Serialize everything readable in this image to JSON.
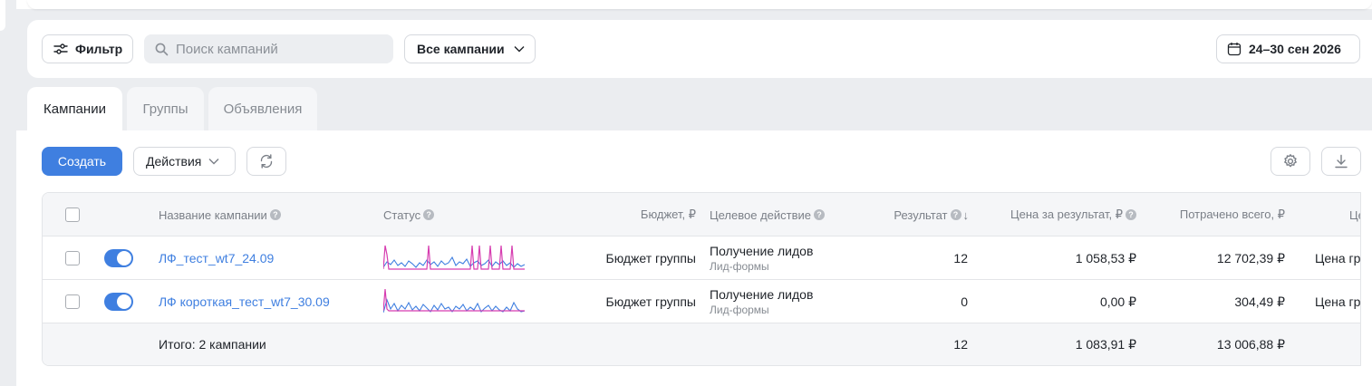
{
  "filter_bar": {
    "filter_label": "Фильтр",
    "search_placeholder": "Поиск кампаний",
    "campaign_select": "Все кампании",
    "date_range": "24–30 сен 2026"
  },
  "tabs": [
    {
      "label": "Кампании",
      "active": true
    },
    {
      "label": "Группы",
      "active": false
    },
    {
      "label": "Объявления",
      "active": false
    }
  ],
  "toolbar": {
    "create_label": "Создать",
    "actions_label": "Действия"
  },
  "table": {
    "headers": {
      "name": "Название кампании",
      "status": "Статус",
      "budget": "Бюджет, ₽",
      "goal": "Целевое действие",
      "result": "Результат",
      "price": "Цена за результат, ₽",
      "spent": "Потрачено всего, ₽",
      "extra": "Це"
    },
    "rows": [
      {
        "name": "ЛФ_тест_wt7_24.09",
        "budget": "Бюджет группы",
        "goal": "Получение лидов",
        "goal_sub": "Лид-формы",
        "result": "12",
        "price": "1 058,53 ₽",
        "spent": "12 702,39 ₽",
        "extra": "Цена гр",
        "enabled": true
      },
      {
        "name": "ЛФ короткая_тест_wt7_30.09",
        "budget": "Бюджет группы",
        "goal": "Получение лидов",
        "goal_sub": "Лид-формы",
        "result": "0",
        "price": "0,00 ₽",
        "spent": "304,49 ₽",
        "extra": "Цена гр",
        "enabled": true
      }
    ],
    "totals": {
      "label": "Итого: 2 кампании",
      "result": "12",
      "price": "1 083,91 ₽",
      "spent": "13 006,88 ₽"
    }
  },
  "colors": {
    "accent": "#3f7fe0",
    "spark_blue": "#3f7fe0",
    "spark_pink": "#d63cb0"
  }
}
